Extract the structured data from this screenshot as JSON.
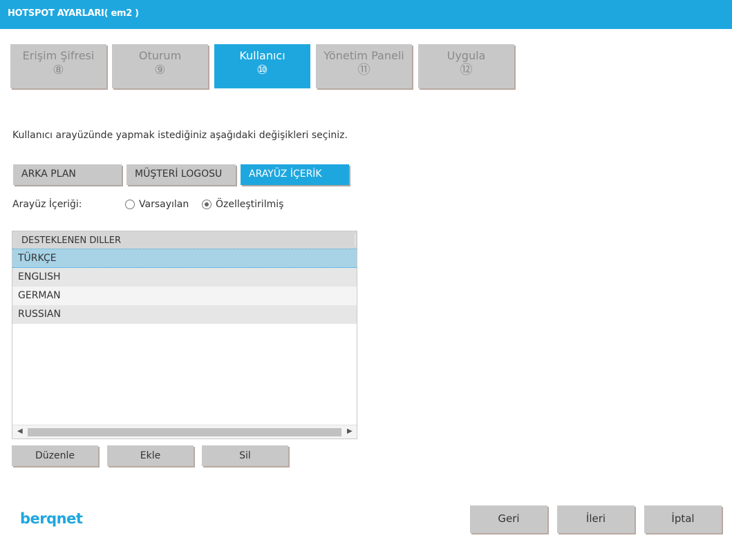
{
  "window": {
    "title": "HOTSPOT AYARLARI( em2 )"
  },
  "steps": [
    {
      "label": "Erişim Şifresi",
      "number": "⑧",
      "active": false
    },
    {
      "label": "Oturum",
      "number": "⑨",
      "active": false
    },
    {
      "label": "Kullanıcı",
      "number": "⑩",
      "active": true
    },
    {
      "label": "Yönetim Paneli",
      "number": "⑪",
      "active": false
    },
    {
      "label": "Uygula",
      "number": "⑫",
      "active": false
    }
  ],
  "instruction": "Kullanıcı arayüzünde yapmak istediğiniz aşağıdaki değişikleri seçiniz.",
  "subtabs": [
    {
      "label": "ARKA PLAN",
      "active": false
    },
    {
      "label": "MÜŞTERİ LOGOSU",
      "active": false
    },
    {
      "label": "ARAYÜZ İÇERİK",
      "active": true
    }
  ],
  "content_mode": {
    "label": "Arayüz İçeriği:",
    "options": [
      {
        "label": "Varsayılan",
        "checked": false
      },
      {
        "label": "Özelleştirilmiş",
        "checked": true
      }
    ]
  },
  "languages": {
    "header": "DESTEKLENEN DILLER",
    "rows": [
      "TÜRKÇE",
      "ENGLISH",
      "GERMAN",
      "RUSSIAN"
    ],
    "selected_index": 0
  },
  "actions": {
    "edit": "Düzenle",
    "add": "Ekle",
    "delete": "Sil"
  },
  "brand": {
    "logo_text": "berqnet",
    "accent_color": "#1ea7df"
  },
  "footer": {
    "back": "Geri",
    "next": "İleri",
    "cancel": "İptal"
  },
  "icons": {
    "scroll_left": "scroll-left-arrow-icon",
    "scroll_right": "scroll-right-arrow-icon"
  }
}
